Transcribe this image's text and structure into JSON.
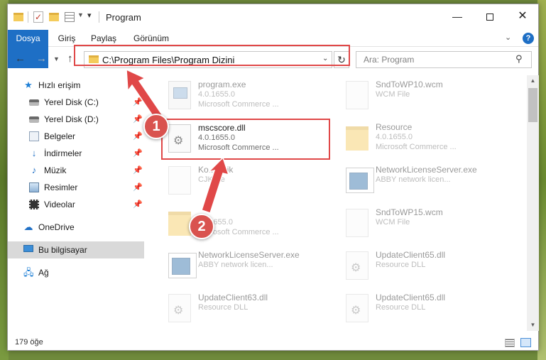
{
  "window": {
    "title": "Program",
    "controls": {
      "minimize": "—",
      "maximize": "",
      "close": "✕"
    }
  },
  "ribbon": {
    "tabs": [
      {
        "label": "Dosya",
        "active": true
      },
      {
        "label": "Giriş"
      },
      {
        "label": "Paylaş"
      },
      {
        "label": "Görünüm"
      }
    ],
    "help": "?"
  },
  "navigation": {
    "address": "C:\\Program Files\\Program Dizini",
    "search_placeholder": "Ara: Program"
  },
  "sidebar": {
    "items": [
      {
        "label": "Hızlı erişim",
        "icon": "star-icon",
        "pinned": false
      },
      {
        "label": "Yerel Disk (C:)",
        "icon": "drive-icon",
        "pinned": true
      },
      {
        "label": "Yerel Disk (D:)",
        "icon": "drive-icon",
        "pinned": true
      },
      {
        "label": "Belgeler",
        "icon": "documents-icon",
        "pinned": true
      },
      {
        "label": "İndirmeler",
        "icon": "downloads-icon",
        "pinned": true
      },
      {
        "label": "Müzik",
        "icon": "music-icon",
        "pinned": true
      },
      {
        "label": "Resimler",
        "icon": "pictures-icon",
        "pinned": true
      },
      {
        "label": "Videolar",
        "icon": "videos-icon",
        "pinned": true
      },
      {
        "label": "OneDrive",
        "icon": "onedrive-icon"
      },
      {
        "label": "Bu bilgisayar",
        "icon": "computer-icon",
        "selected": true
      },
      {
        "label": "Ağ",
        "icon": "network-icon"
      }
    ]
  },
  "files": [
    {
      "name": "program.exe",
      "line1": "4.0.1655.0",
      "line2": "Microsoft Commerce ...",
      "icon": "exe-icon"
    },
    {
      "name": "SndToWP10.wcm",
      "line1": "WCM File",
      "line2": "",
      "icon": "file-icon"
    },
    {
      "name": "mscscore.dll",
      "line1": "4.0.1655.0",
      "line2": "Microsoft Commerce ...",
      "icon": "dll-icon"
    },
    {
      "name": "Resource",
      "line1": "4.0.1655.0",
      "line2": "Microsoft Commerce ...",
      "icon": "folder-icon"
    },
    {
      "name": "Ko...n.cjk",
      "line1": "CJK file",
      "line2": "",
      "icon": "file-icon"
    },
    {
      "name": "NetworkLicenseServer.exe",
      "line1": "ABBY network licen...",
      "line2": "",
      "icon": "netexe-icon"
    },
    {
      "name": "",
      "line1": "4...1655.0",
      "line2": "Microsoft Commerce ...",
      "icon": "folder-icon"
    },
    {
      "name": "SndToWP15.wcm",
      "line1": "WCM File",
      "line2": "",
      "icon": "file-icon"
    },
    {
      "name": "NetworkLicenseServer.exe",
      "line1": "ABBY network licen...",
      "line2": "",
      "icon": "netexe-icon"
    },
    {
      "name": "UpdateClient65.dll",
      "line1": "Resource DLL",
      "line2": "",
      "icon": "dll-icon"
    },
    {
      "name": "UpdateClient63.dll",
      "line1": "Resource DLL",
      "line2": "",
      "icon": "dll-icon"
    },
    {
      "name": "UpdateClient65.dll",
      "line1": "Resource DLL",
      "line2": "",
      "icon": "dll-icon"
    }
  ],
  "status": {
    "count": "179 öğe"
  },
  "callouts": [
    "1",
    "2"
  ],
  "colors": {
    "accent": "#1e6fc5",
    "highlight": "#e04848",
    "callout": "#d9534f"
  }
}
